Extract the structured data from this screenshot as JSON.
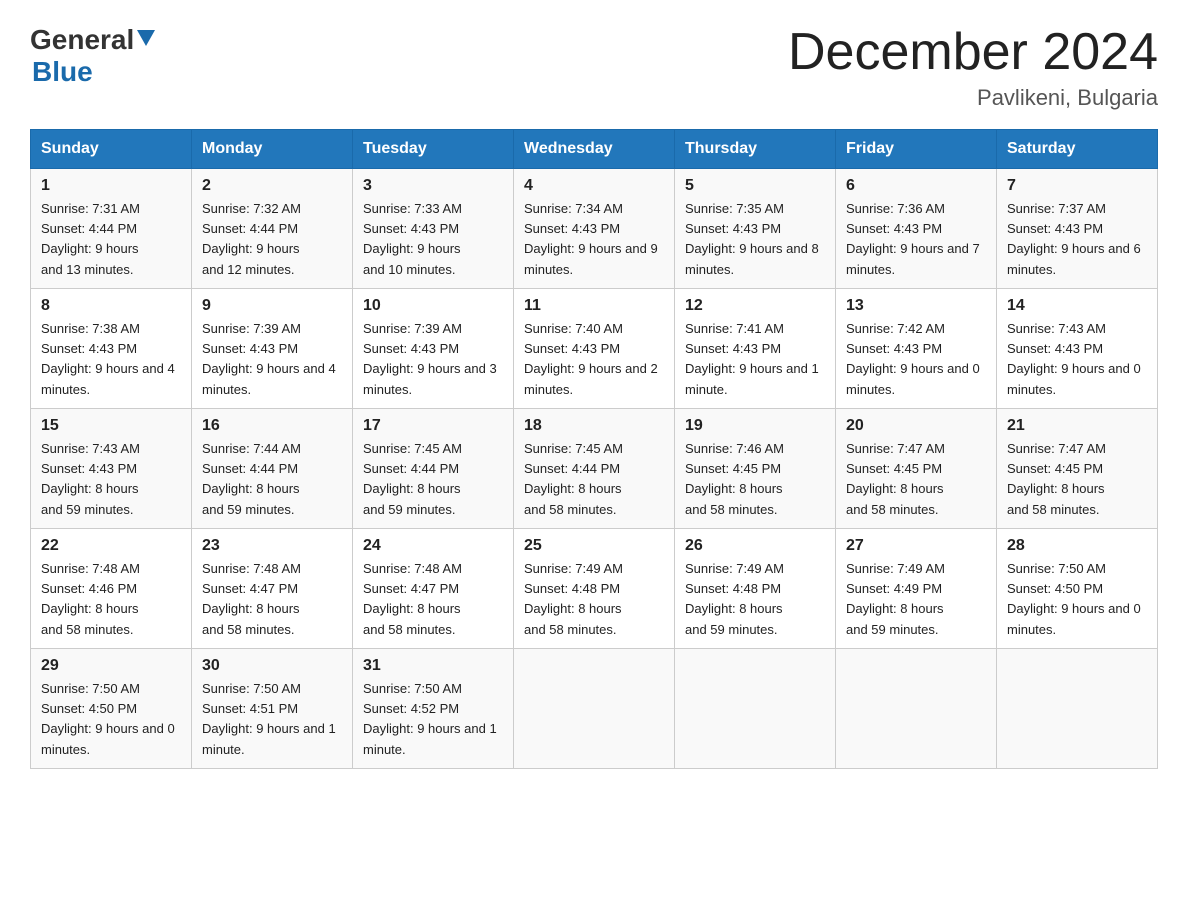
{
  "logo": {
    "general": "General",
    "blue": "Blue"
  },
  "header": {
    "month": "December 2024",
    "location": "Pavlikeni, Bulgaria"
  },
  "weekdays": [
    "Sunday",
    "Monday",
    "Tuesday",
    "Wednesday",
    "Thursday",
    "Friday",
    "Saturday"
  ],
  "weeks": [
    [
      {
        "day": "1",
        "sunrise": "7:31 AM",
        "sunset": "4:44 PM",
        "daylight": "9 hours and 13 minutes."
      },
      {
        "day": "2",
        "sunrise": "7:32 AM",
        "sunset": "4:44 PM",
        "daylight": "9 hours and 12 minutes."
      },
      {
        "day": "3",
        "sunrise": "7:33 AM",
        "sunset": "4:43 PM",
        "daylight": "9 hours and 10 minutes."
      },
      {
        "day": "4",
        "sunrise": "7:34 AM",
        "sunset": "4:43 PM",
        "daylight": "9 hours and 9 minutes."
      },
      {
        "day": "5",
        "sunrise": "7:35 AM",
        "sunset": "4:43 PM",
        "daylight": "9 hours and 8 minutes."
      },
      {
        "day": "6",
        "sunrise": "7:36 AM",
        "sunset": "4:43 PM",
        "daylight": "9 hours and 7 minutes."
      },
      {
        "day": "7",
        "sunrise": "7:37 AM",
        "sunset": "4:43 PM",
        "daylight": "9 hours and 6 minutes."
      }
    ],
    [
      {
        "day": "8",
        "sunrise": "7:38 AM",
        "sunset": "4:43 PM",
        "daylight": "9 hours and 4 minutes."
      },
      {
        "day": "9",
        "sunrise": "7:39 AM",
        "sunset": "4:43 PM",
        "daylight": "9 hours and 4 minutes."
      },
      {
        "day": "10",
        "sunrise": "7:39 AM",
        "sunset": "4:43 PM",
        "daylight": "9 hours and 3 minutes."
      },
      {
        "day": "11",
        "sunrise": "7:40 AM",
        "sunset": "4:43 PM",
        "daylight": "9 hours and 2 minutes."
      },
      {
        "day": "12",
        "sunrise": "7:41 AM",
        "sunset": "4:43 PM",
        "daylight": "9 hours and 1 minute."
      },
      {
        "day": "13",
        "sunrise": "7:42 AM",
        "sunset": "4:43 PM",
        "daylight": "9 hours and 0 minutes."
      },
      {
        "day": "14",
        "sunrise": "7:43 AM",
        "sunset": "4:43 PM",
        "daylight": "9 hours and 0 minutes."
      }
    ],
    [
      {
        "day": "15",
        "sunrise": "7:43 AM",
        "sunset": "4:43 PM",
        "daylight": "8 hours and 59 minutes."
      },
      {
        "day": "16",
        "sunrise": "7:44 AM",
        "sunset": "4:44 PM",
        "daylight": "8 hours and 59 minutes."
      },
      {
        "day": "17",
        "sunrise": "7:45 AM",
        "sunset": "4:44 PM",
        "daylight": "8 hours and 59 minutes."
      },
      {
        "day": "18",
        "sunrise": "7:45 AM",
        "sunset": "4:44 PM",
        "daylight": "8 hours and 58 minutes."
      },
      {
        "day": "19",
        "sunrise": "7:46 AM",
        "sunset": "4:45 PM",
        "daylight": "8 hours and 58 minutes."
      },
      {
        "day": "20",
        "sunrise": "7:47 AM",
        "sunset": "4:45 PM",
        "daylight": "8 hours and 58 minutes."
      },
      {
        "day": "21",
        "sunrise": "7:47 AM",
        "sunset": "4:45 PM",
        "daylight": "8 hours and 58 minutes."
      }
    ],
    [
      {
        "day": "22",
        "sunrise": "7:48 AM",
        "sunset": "4:46 PM",
        "daylight": "8 hours and 58 minutes."
      },
      {
        "day": "23",
        "sunrise": "7:48 AM",
        "sunset": "4:47 PM",
        "daylight": "8 hours and 58 minutes."
      },
      {
        "day": "24",
        "sunrise": "7:48 AM",
        "sunset": "4:47 PM",
        "daylight": "8 hours and 58 minutes."
      },
      {
        "day": "25",
        "sunrise": "7:49 AM",
        "sunset": "4:48 PM",
        "daylight": "8 hours and 58 minutes."
      },
      {
        "day": "26",
        "sunrise": "7:49 AM",
        "sunset": "4:48 PM",
        "daylight": "8 hours and 59 minutes."
      },
      {
        "day": "27",
        "sunrise": "7:49 AM",
        "sunset": "4:49 PM",
        "daylight": "8 hours and 59 minutes."
      },
      {
        "day": "28",
        "sunrise": "7:50 AM",
        "sunset": "4:50 PM",
        "daylight": "9 hours and 0 minutes."
      }
    ],
    [
      {
        "day": "29",
        "sunrise": "7:50 AM",
        "sunset": "4:50 PM",
        "daylight": "9 hours and 0 minutes."
      },
      {
        "day": "30",
        "sunrise": "7:50 AM",
        "sunset": "4:51 PM",
        "daylight": "9 hours and 1 minute."
      },
      {
        "day": "31",
        "sunrise": "7:50 AM",
        "sunset": "4:52 PM",
        "daylight": "9 hours and 1 minute."
      },
      null,
      null,
      null,
      null
    ]
  ],
  "labels": {
    "sunrise": "Sunrise:",
    "sunset": "Sunset:",
    "daylight": "Daylight:"
  }
}
